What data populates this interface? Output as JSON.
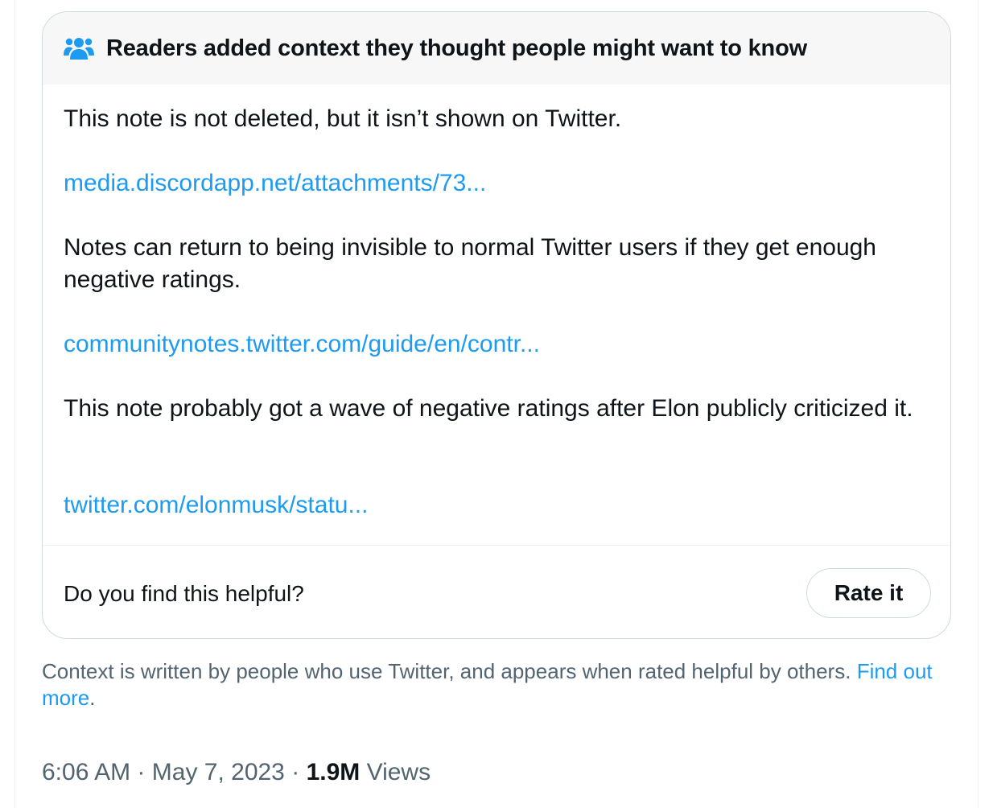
{
  "note": {
    "header_title": "Readers added context they thought people might want to know",
    "header_icon": "people-icon",
    "paragraph_1": "This note is not deleted, but it isn’t shown on Twitter.",
    "link_1": "media.discordapp.net/attachments/73...",
    "paragraph_2": "Notes can return to being invisible to normal Twitter users if they get enough negative ratings.",
    "link_2": "communitynotes.twitter.com/guide/en/contr...",
    "paragraph_3": "This note probably got a wave of negative ratings after Elon publicly criticized it.",
    "link_3": "twitter.com/elonmusk/statu...",
    "helpful_question": "Do you find this helpful?",
    "rate_button": "Rate it"
  },
  "footer": {
    "context_text": "Context is written by people who use Twitter, and appears when rated helpful by others.",
    "find_out_more_link": "Find out more",
    "period": "."
  },
  "meta": {
    "time": "6:06 AM",
    "separator_1": "·",
    "date": "May 7, 2023",
    "separator_2": "·",
    "views_count": "1.9M",
    "views_label": "Views"
  },
  "colors": {
    "link": "#1d9bf0",
    "text": "#0f1419",
    "secondary_text": "#536471",
    "border": "#cfd9de",
    "header_bg": "#f7f7f7"
  }
}
